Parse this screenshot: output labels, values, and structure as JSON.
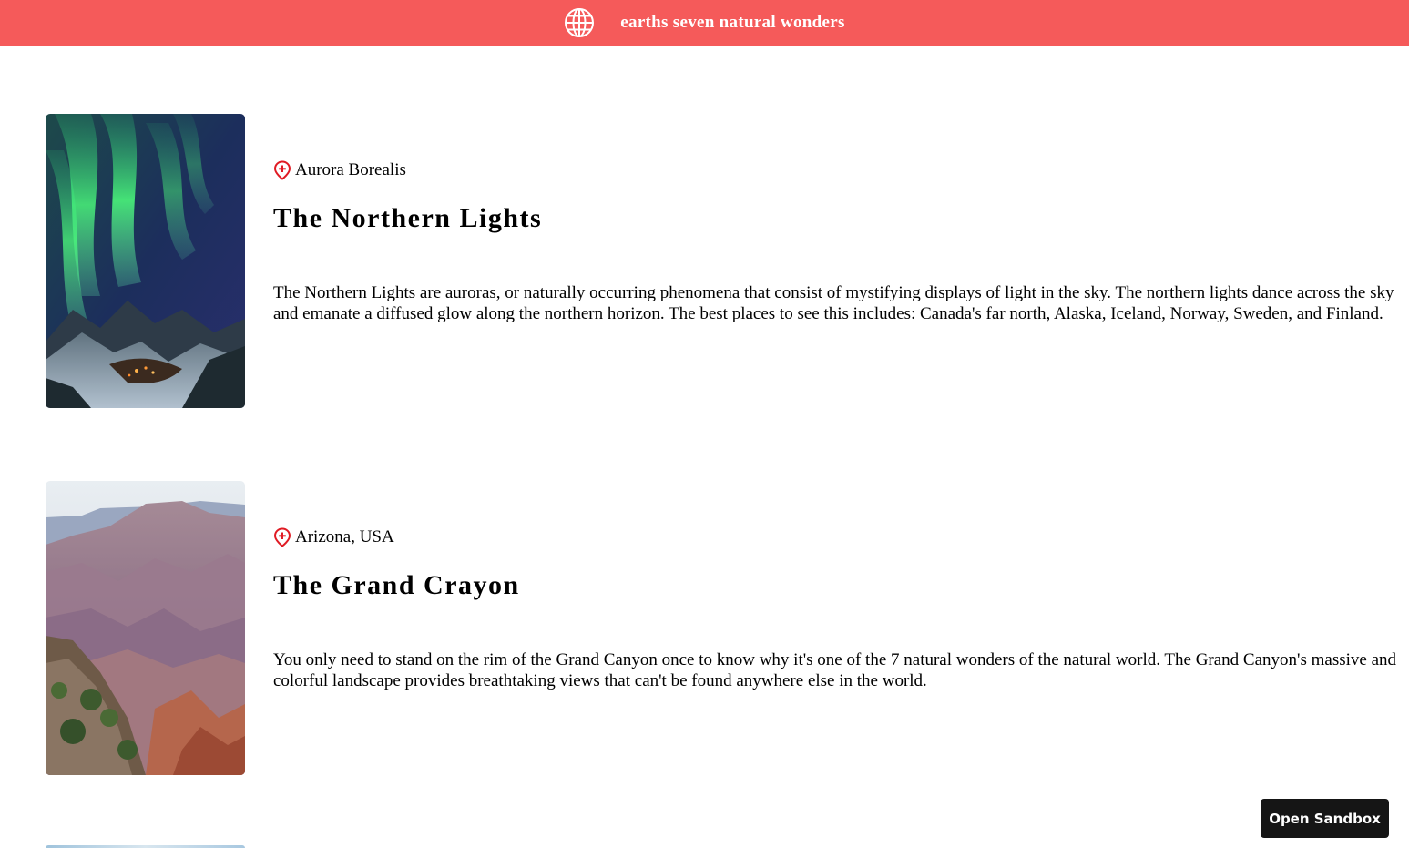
{
  "header": {
    "title": "earths seven natural wonders",
    "icon": "globe-icon",
    "background": "#f55a5a"
  },
  "cards": [
    {
      "location": "Aurora Borealis",
      "title": "The Northern Lights",
      "description": "The Northern Lights are auroras, or naturally occurring phenomena that consist of mystifying displays of light in the sky. The northern lights dance across the sky and emanate a diffused glow along the northern horizon. The best places to see this includes: Canada's far north, Alaska, Iceland, Norway, Sweden, and Finland.",
      "image": "aurora-photo",
      "pin_icon": "location-pin-icon"
    },
    {
      "location": "Arizona, USA",
      "title": "The Grand Crayon",
      "description": "You only need to stand on the rim of the Grand Canyon once to know why it's one of the 7 natural wonders of the natural world. The Grand Canyon's massive and colorful landscape provides breathtaking views that can't be found anywhere else in the world.",
      "image": "grand-canyon-photo",
      "pin_icon": "location-pin-icon"
    }
  ],
  "sandbox_button": {
    "label": "Open Sandbox"
  },
  "colors": {
    "accent": "#f55a5a",
    "pin": "#e01b24",
    "button_bg": "#151515"
  }
}
